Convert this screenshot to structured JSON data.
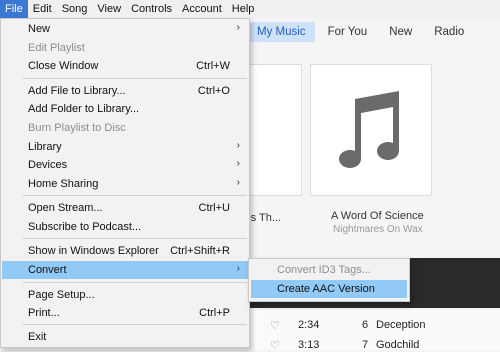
{
  "menubar": [
    "File",
    "Edit",
    "Song",
    "View",
    "Controls",
    "Account",
    "Help"
  ],
  "tabs": {
    "my_music": "My Music",
    "for_you": "For You",
    "new": "New",
    "radio": "Radio"
  },
  "albums": [
    {
      "title": "ings Th...",
      "artist": ""
    },
    {
      "title": "A Word Of Science",
      "artist": "Nightmares On Wax"
    }
  ],
  "tracks": [
    {
      "time": "2:34",
      "number": "6",
      "name": "Deception"
    },
    {
      "time": "3:13",
      "number": "7",
      "name": "Godchild"
    }
  ],
  "file_menu": {
    "new": "New",
    "edit_playlist": "Edit Playlist",
    "close_window": "Close Window",
    "close_window_shortcut": "Ctrl+W",
    "add_file": "Add File to Library...",
    "add_file_shortcut": "Ctrl+O",
    "add_folder": "Add Folder to Library...",
    "burn_playlist": "Burn Playlist to Disc",
    "library": "Library",
    "devices": "Devices",
    "home_sharing": "Home Sharing",
    "open_stream": "Open Stream...",
    "open_stream_shortcut": "Ctrl+U",
    "subscribe_podcast": "Subscribe to Podcast...",
    "show_in_explorer": "Show in Windows Explorer",
    "show_in_explorer_shortcut": "Ctrl+Shift+R",
    "convert": "Convert",
    "page_setup": "Page Setup...",
    "print": "Print...",
    "print_shortcut": "Ctrl+P",
    "exit": "Exit"
  },
  "convert_submenu": {
    "convert_id3": "Convert ID3 Tags...",
    "create_aac": "Create AAC Version"
  },
  "icons": {
    "submenu_arrow": "chevron-right-icon",
    "music_note": "music-note-icon",
    "heart": "heart-icon"
  },
  "colors": {
    "menu_highlight": "#91c9f7",
    "active_tab_bg": "#cfe1f6",
    "active_tab_text": "#1f5fbf",
    "menubar_active": "#3a78d4"
  }
}
